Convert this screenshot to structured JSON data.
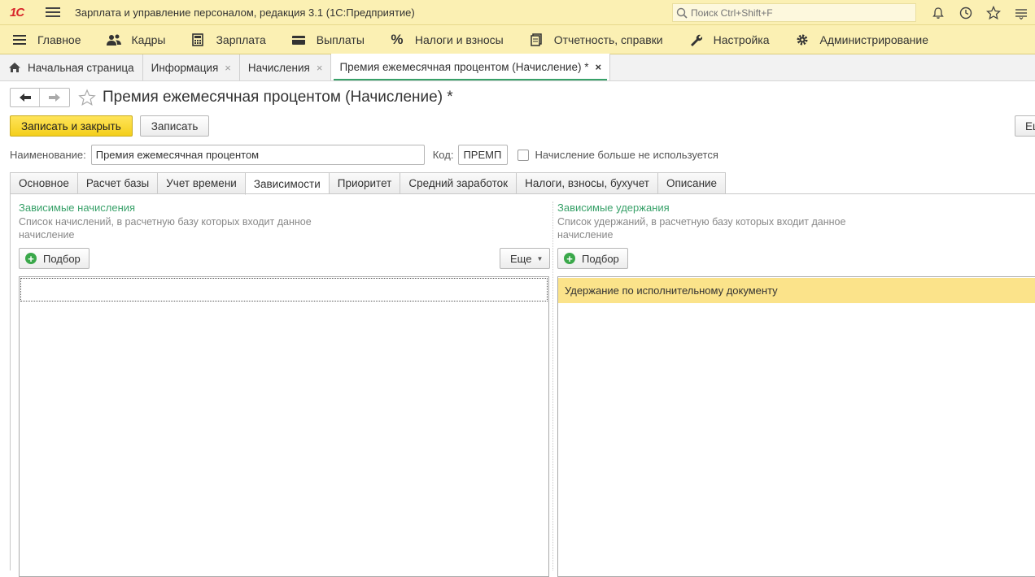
{
  "titlebar": {
    "logo": "1С",
    "title": "Зарплата и управление персоналом, редакция 3.1  (1С:Предприятие)",
    "search_placeholder": "Поиск Ctrl+Shift+F"
  },
  "menu": [
    {
      "label": "Главное",
      "icon": "hamburger-icon"
    },
    {
      "label": "Кадры",
      "icon": "people-icon"
    },
    {
      "label": "Зарплата",
      "icon": "calculator-icon"
    },
    {
      "label": "Выплаты",
      "icon": "wallet-icon"
    },
    {
      "label": "Налоги и взносы",
      "icon": "percent-icon"
    },
    {
      "label": "Отчетность, справки",
      "icon": "report-icon"
    },
    {
      "label": "Настройка",
      "icon": "wrench-icon"
    },
    {
      "label": "Администрирование",
      "icon": "gear-icon"
    }
  ],
  "windows": {
    "home": "Начальная страница",
    "info": "Информация",
    "accruals": "Начисления",
    "current": "Премия ежемесячная процентом (Начисление) *",
    "close_glyph": "×"
  },
  "form": {
    "title": "Премия ежемесячная процентом (Начисление) *",
    "save_close": "Записать и закрыть",
    "save": "Записать",
    "more_right": "Ещ",
    "name_label": "Наименование:",
    "name_value": "Премия ежемесячная процентом",
    "code_label": "Код:",
    "code_value": "ПРЕМП",
    "unused_label": "Начисление больше не используется"
  },
  "tabs": [
    "Основное",
    "Расчет базы",
    "Учет времени",
    "Зависимости",
    "Приоритет",
    "Средний заработок",
    "Налоги, взносы, бухучет",
    "Описание"
  ],
  "active_tab": "Зависимости",
  "left_group": {
    "title": "Зависимые начисления",
    "desc": "Список начислений, в расчетную базу которых входит данное начисление",
    "pick": "Подбор",
    "more": "Еще"
  },
  "right_group": {
    "title": "Зависимые удержания",
    "desc": "Список удержаний, в расчетную базу которых входит данное начисление",
    "pick": "Подбор",
    "rows": [
      "Удержание по исполнительному документу"
    ]
  }
}
